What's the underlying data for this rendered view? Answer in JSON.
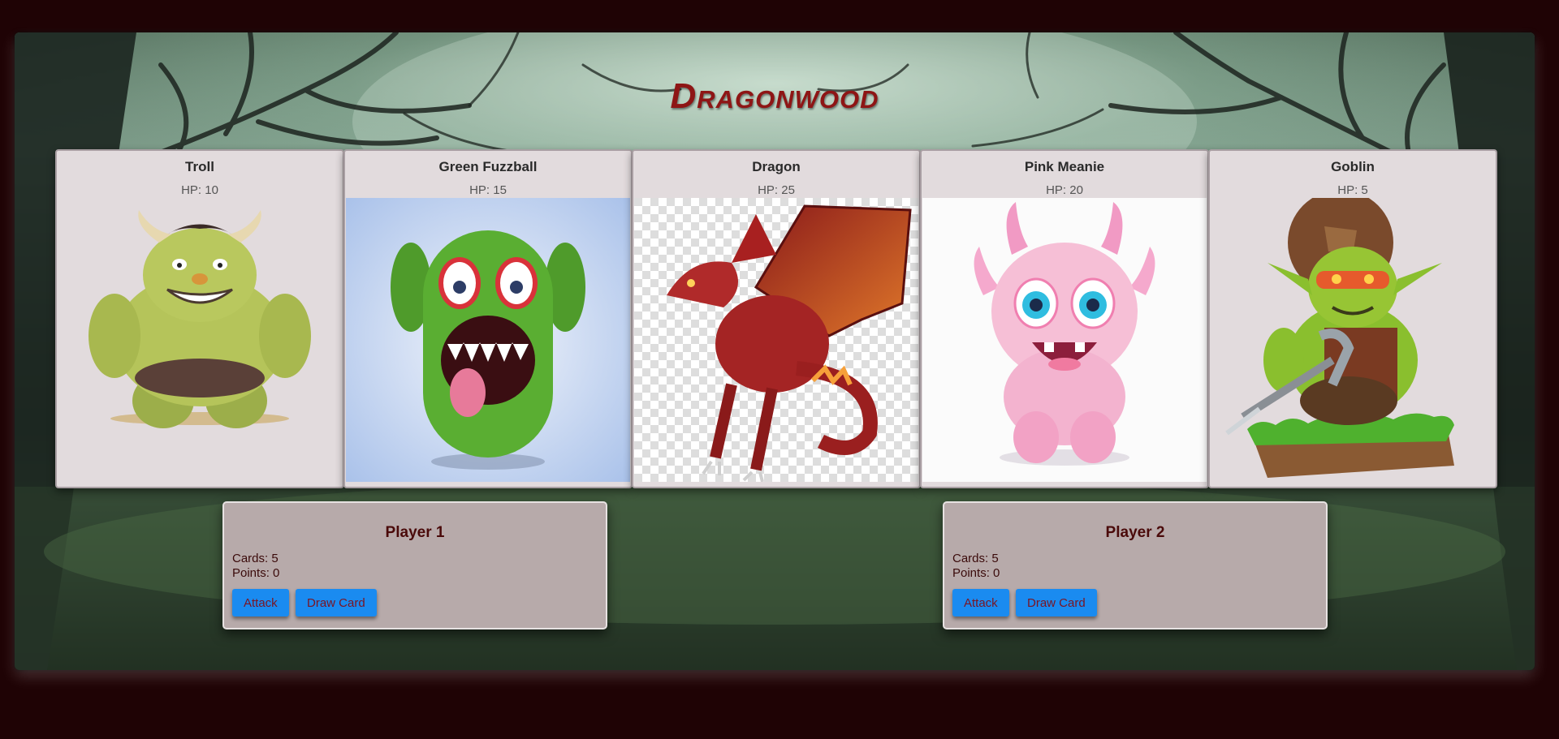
{
  "game": {
    "title": "Dragonwood"
  },
  "monsters": [
    {
      "name": "Troll",
      "hp_label": "HP: 10"
    },
    {
      "name": "Green Fuzzball",
      "hp_label": "HP: 15"
    },
    {
      "name": "Dragon",
      "hp_label": "HP: 25"
    },
    {
      "name": "Pink Meanie",
      "hp_label": "HP: 20"
    },
    {
      "name": "Goblin",
      "hp_label": "HP: 5"
    }
  ],
  "players": [
    {
      "name": "Player 1",
      "cards": "Cards: 5",
      "points": "Points: 0",
      "attack_label": "Attack",
      "draw_label": "Draw Card"
    },
    {
      "name": "Player 2",
      "cards": "Cards: 5",
      "points": "Points: 0",
      "attack_label": "Attack",
      "draw_label": "Draw Card"
    }
  ],
  "colors": {
    "page_background": "#1f0305",
    "title": "#8e1515",
    "card_background": "#e2dbdd",
    "panel_background": "#b7aaaa",
    "button": "#1a8bf0",
    "button_text": "#7a1523"
  }
}
